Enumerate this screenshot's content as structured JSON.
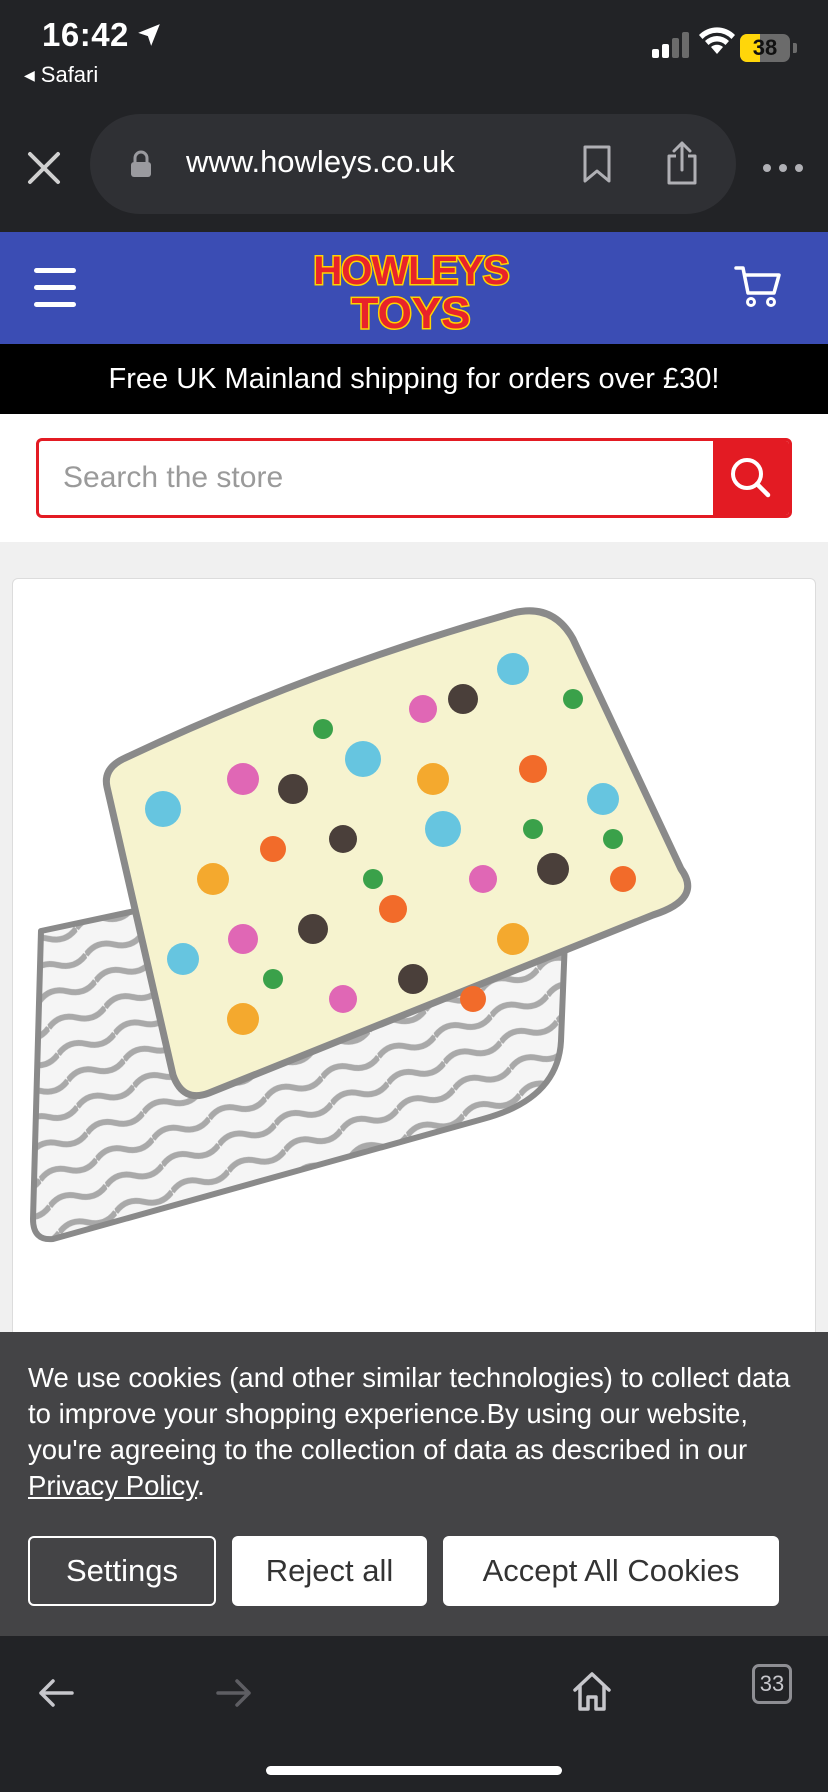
{
  "status_bar": {
    "time": "16:42",
    "back_app": "Safari",
    "battery": "38"
  },
  "browser": {
    "url": "www.howleys.co.uk",
    "tab_count": "33"
  },
  "site": {
    "logo_line1": "HOWLEYS",
    "logo_line2": "TOYS",
    "shipping_banner": "Free UK Mainland shipping for orders over £30!",
    "search_placeholder": "Search the store"
  },
  "cookie_banner": {
    "text": "We use cookies (and other similar technologies) to collect data to improve your shopping experience.By using our website, you're agreeing to the collection of data as described in our ",
    "privacy_link": "Privacy Policy",
    "trailing": ".",
    "settings_label": "Settings",
    "reject_label": "Reject all",
    "accept_label": "Accept All Cookies"
  },
  "colors": {
    "header_blue": "#3b4db4",
    "search_red": "#e31b23",
    "logo_red": "#e8232a",
    "logo_yellow": "#ffd400"
  }
}
